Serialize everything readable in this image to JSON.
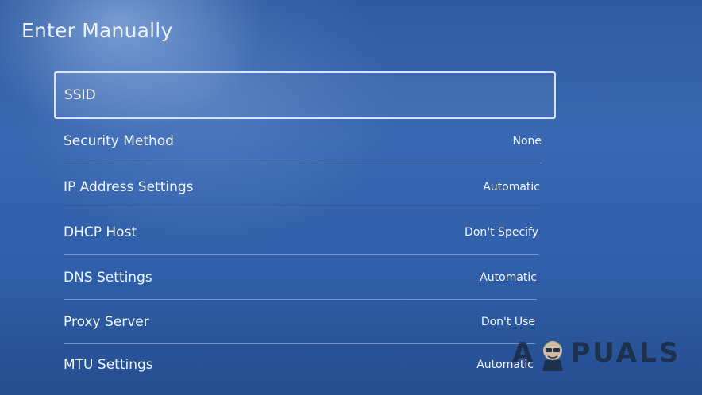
{
  "header": {
    "title": "Enter Manually"
  },
  "settings": [
    {
      "label": "SSID",
      "value": ""
    },
    {
      "label": "Security Method",
      "value": "None"
    },
    {
      "label": "IP Address Settings",
      "value": "Automatic"
    },
    {
      "label": "DHCP Host",
      "value": "Don't Specify"
    },
    {
      "label": "DNS Settings",
      "value": "Automatic"
    },
    {
      "label": "Proxy Server",
      "value": "Don't Use"
    },
    {
      "label": "MTU Settings",
      "value": "Automatic"
    }
  ],
  "watermark": {
    "prefix": "A",
    "suffix": "PUALS",
    "icon": "appuals-mascot-icon"
  },
  "colors": {
    "background_top": "#2f5aa3",
    "background_bottom": "#264d8f",
    "text": "#f2f6fc",
    "focus_border": "#ebf2fc"
  }
}
